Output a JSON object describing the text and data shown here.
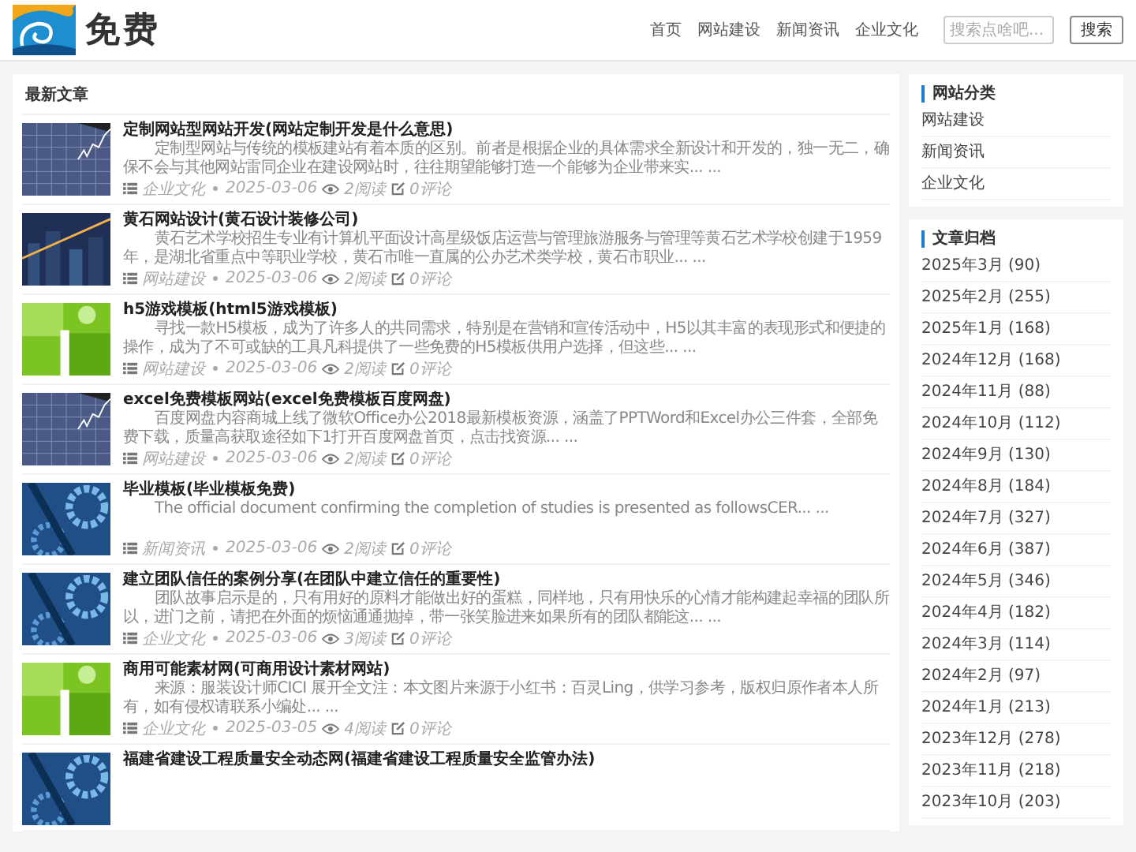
{
  "header": {
    "logo_text": "免费",
    "nav": [
      {
        "label": "首页"
      },
      {
        "label": "网站建设"
      },
      {
        "label": "新闻资讯"
      },
      {
        "label": "企业文化"
      }
    ],
    "search": {
      "placeholder": "搜索点啥吧...",
      "button": "搜索"
    }
  },
  "main": {
    "title": "最新文章",
    "articles": [
      {
        "kind": "chart",
        "title": "定制网站型网站开发(网站定制开发是什么意思)",
        "excerpt": "定制型网站与传统的模板建站有着本质的区别。前者是根据企业的具体需求全新设计和开发的，独一无二，确保不会与其他网站雷同企业在建设网站时，往往期望能够打造一个能够为企业带来实... ...",
        "category": "企业文化",
        "date": "2025-03-06",
        "views": "2阅读",
        "comments": "0评论"
      },
      {
        "kind": "city",
        "title": "黄石网站设计(黄石设计装修公司)",
        "excerpt": "黄石艺术学校招生专业有计算机平面设计高星级饭店运营与管理旅游服务与管理等黄石艺术学校创建于1959年，是湖北省重点中等职业学校，黄石市唯一直属的公办艺术类学校，黄石市职业... ...",
        "category": "网站建设",
        "date": "2025-03-06",
        "views": "2阅读",
        "comments": "0评论"
      },
      {
        "kind": "green",
        "title": "h5游戏模板(html5游戏模板)",
        "excerpt": "寻找一款H5模板，成为了许多人的共同需求，特别是在营销和宣传活动中，H5以其丰富的表现形式和便捷的操作，成为了不可或缺的工具凡科提供了一些免费的H5模板供用户选择，但这些... ...",
        "category": "网站建设",
        "date": "2025-03-06",
        "views": "2阅读",
        "comments": "0评论"
      },
      {
        "kind": "chart",
        "title": "excel免费模板网站(excel免费模板百度网盘)",
        "excerpt": "百度网盘内容商城上线了微软Office办公2018最新模板资源，涵盖了PPTWord和Excel办公三件套，全部免费下载，质量高获取途径如下1打开百度网盘首页，点击找资源... ...",
        "category": "网站建设",
        "date": "2025-03-06",
        "views": "2阅读",
        "comments": "0评论"
      },
      {
        "kind": "gears",
        "title": "毕业模板(毕业模板免费)",
        "excerpt": "The official document confirming the completion of studies is presented as followsCER... ...",
        "category": "新闻资讯",
        "date": "2025-03-06",
        "views": "2阅读",
        "comments": "0评论"
      },
      {
        "kind": "gears",
        "title": "建立团队信任的案例分享(在团队中建立信任的重要性)",
        "excerpt": "团队故事启示是的，只有用好的原料才能做出好的蛋糕，同样地，只有用快乐的心情才能构建起幸福的团队所以，进门之前，请把在外面的烦恼通通抛掉，带一张笑脸进来如果所有的团队都能这... ...",
        "category": "企业文化",
        "date": "2025-03-06",
        "views": "3阅读",
        "comments": "0评论"
      },
      {
        "kind": "green",
        "title": "商用可能素材网(可商用设计素材网站)",
        "excerpt": "来源：服装设计师CICI 展开全文注：本文图片来源于小红书：百灵Ling，供学习参考，版权归原作者本人所有，如有侵权请联系小编处... ...",
        "category": "企业文化",
        "date": "2025-03-05",
        "views": "4阅读",
        "comments": "0评论"
      },
      {
        "kind": "gears",
        "title": "福建省建设工程质量安全动态网(福建省建设工程质量安全监管办法)"
      }
    ]
  },
  "sidebar": {
    "categories": {
      "title": "网站分类",
      "items": [
        "网站建设",
        "新闻资讯",
        "企业文化"
      ]
    },
    "archive": {
      "title": "文章归档",
      "items": [
        "2025年3月 (90)",
        "2025年2月 (255)",
        "2025年1月 (168)",
        "2024年12月 (168)",
        "2024年11月 (88)",
        "2024年10月 (112)",
        "2024年9月 (130)",
        "2024年8月 (184)",
        "2024年7月 (327)",
        "2024年6月 (387)",
        "2024年5月 (346)",
        "2024年4月 (182)",
        "2024年3月 (114)",
        "2024年2月 (97)",
        "2024年1月 (213)",
        "2023年12月 (278)",
        "2023年11月 (218)",
        "2023年10月 (203)"
      ]
    }
  }
}
